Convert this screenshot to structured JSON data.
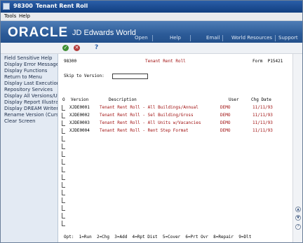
{
  "window": {
    "code": "98300",
    "title": "Tenant Rent Roll"
  },
  "menu": [
    "Tools",
    "Help"
  ],
  "banner": {
    "logo": "ORACLE",
    "product": "JD Edwards World",
    "nav": [
      "Open",
      "Help",
      "Email",
      "World Resources",
      "Support"
    ]
  },
  "toolbar": {
    "ok_icon": "check-icon",
    "cancel_icon": "x-icon",
    "help": "?"
  },
  "sidebar": {
    "items": [
      "Field Sensitive Help",
      "Display Error Message",
      "Display Functions",
      "Return to Menu",
      "Display Last Execution/",
      "Repository Services",
      "Display All Versions/Us",
      "Display Report Illustrati",
      "Display DREAM Writer I",
      "Rename Version (Cursc",
      "Clear Screen"
    ]
  },
  "form": {
    "program": "98300",
    "title": "Tenant Rent Roll",
    "form_id": "Form  P15421",
    "skip_label": "Skip to Version:",
    "skip_value": ""
  },
  "grid": {
    "headers": {
      "o": "O",
      "version": "Version",
      "description": "Description",
      "user": "User",
      "chg_date": "Chg Date"
    },
    "rows": [
      {
        "version": "XJDE0001",
        "description": "Tenant Rent Roll - All Buildings/Annual",
        "user": "DEMO",
        "chg_date": "11/11/93"
      },
      {
        "version": "XJDE0002",
        "description": "Tenant Rent Roll - Sel Building/Gross",
        "user": "DEMO",
        "chg_date": "11/11/93"
      },
      {
        "version": "XJDE0003",
        "description": "Tenant Rent Roll - All Units w/Vacancies",
        "user": "DEMO",
        "chg_date": "11/11/93"
      },
      {
        "version": "XJDE0004",
        "description": "Tenant Rent Roll - Rent Step Format",
        "user": "DEMO",
        "chg_date": "11/11/93"
      }
    ]
  },
  "options": "Opt:  1=Run  2=Chg  3=Add  4=Rpt Dist  5=Cover  6=Prt Ovr  8=Repair  9=Dlt",
  "colors": {
    "accent": "#2a5ea8",
    "banner": "#2c5b98",
    "red_text": "#a01010",
    "sidebar_bg": "#e3eaf3"
  }
}
